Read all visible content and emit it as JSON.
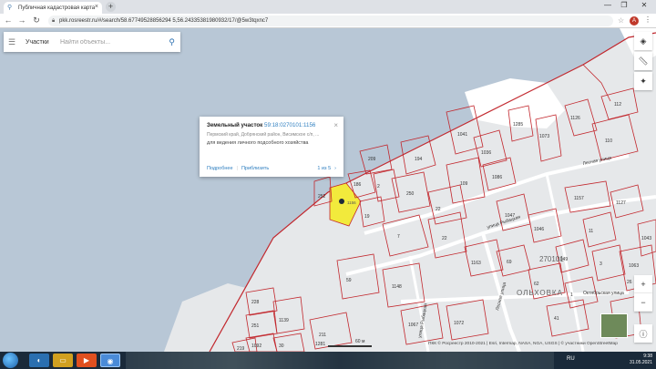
{
  "browser": {
    "tab_title": "Публичная кадастровая карта",
    "tab_close": "×",
    "new_tab": "+",
    "url": "pkk.rosreestr.ru/#/search/58.67749528856294 5,56.24335381980932/17/@5w3tqxnc7",
    "avatar_letter": "A",
    "win_minimize": "—",
    "win_maximize": "❐",
    "win_close": "✕"
  },
  "search": {
    "category": "Участки",
    "placeholder": "Найти объекты..."
  },
  "popup": {
    "title": "Земельный участок",
    "cadastral_number": "59:18:0270101:1156",
    "address": "Пермский край, Добрянский район, Висимское с/п, ...",
    "land_use": "для ведения личного подсобного хозяйства",
    "action_more": "Подробнее",
    "action_zoom": "Приблизить",
    "page": "1 из 5",
    "close": "×",
    "next": "›"
  },
  "map": {
    "street_labels": [
      {
        "text": "Лесная улица"
      },
      {
        "text": "улица Рыбацкая"
      },
      {
        "text": "Лесная улица"
      },
      {
        "text": "Октябрьская улица"
      },
      {
        "text": "улица Рыбацкая"
      }
    ],
    "quarter_label": "270101",
    "village_label": "ОЛЬХОВКА",
    "scale_label": "60 м",
    "attribution": "ПКК © Росреестр 2010-2021 | Esri, Intermap, NASA, NGA, USGS | © участники OpenStreetMap",
    "marker_label": "1156",
    "colors": {
      "water": "#b8c7d6",
      "land": "#e6e8ea",
      "parcel_stroke": "#c2272d",
      "selected_fill": "#f2ea3c",
      "accent": "#2f7fc0"
    },
    "parcel_labels": [
      "186",
      "252",
      "209",
      "194",
      "1041",
      "1036",
      "1086",
      "1285",
      "1073",
      "1126",
      "110",
      "112",
      "2",
      "250",
      "22",
      "109",
      "1047",
      "1163",
      "1157",
      "1127",
      "7",
      "22",
      "19",
      "1046",
      "1049",
      "11",
      "3",
      "1063",
      "1043",
      "62",
      "1",
      "41",
      "34",
      "69",
      "1067",
      "1148",
      "30",
      "228",
      "251",
      "1139",
      "1092",
      "219",
      "59",
      "1072",
      "211",
      "1281",
      "26"
    ]
  },
  "taskbar": {
    "lang": "RU",
    "time": "9:38",
    "date": "31.05.2021"
  }
}
